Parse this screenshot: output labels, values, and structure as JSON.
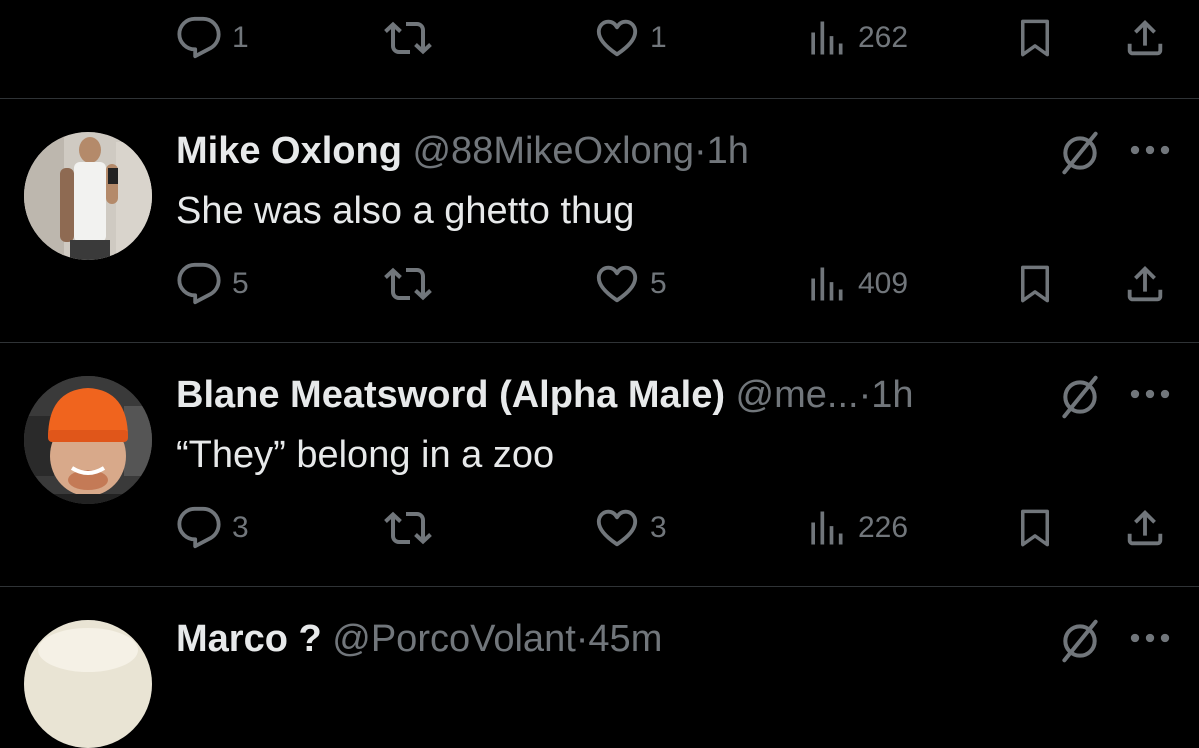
{
  "top_actions": {
    "replies": "1",
    "reposts": "",
    "likes": "1",
    "views": "262"
  },
  "tweets": [
    {
      "name": "Mike Oxlong",
      "handle": "@88MikeOxlong",
      "sep": "·",
      "time": "1h",
      "text": "She was also a ghetto thug",
      "replies": "5",
      "likes": "5",
      "views": "409",
      "avatar_colors": {
        "bg": "#cfcac2",
        "shirt": "#f2f2f0",
        "skin": "#b48a6a"
      }
    },
    {
      "name": "Blane Meatsword (Alpha Male)",
      "handle": "@me...",
      "sep": "·",
      "time": "1h",
      "text": "“They” belong in a zoo",
      "replies": "3",
      "likes": "3",
      "views": "226",
      "avatar_colors": {
        "bg": "#3a3a3a",
        "beanie": "#f0641e",
        "skin": "#d8a98a"
      }
    },
    {
      "name": "Marco ?",
      "handle": "@PorcoVolant",
      "sep": "·",
      "time": "45m",
      "avatar_colors": {
        "bg": "#e9e4d4"
      }
    }
  ],
  "colors": {
    "background": "#000000",
    "text_primary": "#e7e9ea",
    "text_secondary": "#71767b",
    "divider": "#2f3336"
  },
  "icons": [
    "reply-icon",
    "repost-icon",
    "like-icon",
    "views-icon",
    "bookmark-icon",
    "share-icon",
    "grok-icon",
    "more-icon"
  ]
}
